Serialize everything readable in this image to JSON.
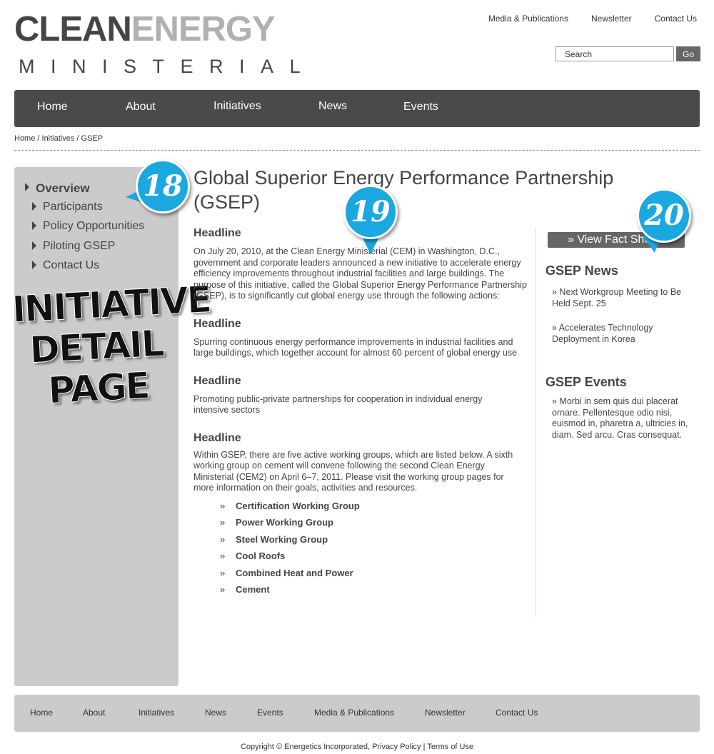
{
  "logo": {
    "word1": "CLEAN",
    "word2": "ENERGY",
    "word3": "MINISTERIAL"
  },
  "toplinks": [
    "Media & Publications",
    "Newsletter",
    "Contact Us"
  ],
  "search": {
    "placeholder": "Search",
    "button": "Go"
  },
  "mainnav": [
    "Home",
    "About",
    "Initiatives",
    "News",
    "Events"
  ],
  "breadcrumb": "Home / Initiatives / GSEP",
  "sidebar": {
    "items": [
      {
        "label": "Overview",
        "active": true
      },
      {
        "label": "Participants"
      },
      {
        "label": "Policy Opportunities"
      },
      {
        "label": "Piloting GSEP"
      },
      {
        "label": "Contact Us"
      }
    ],
    "stamp": [
      "INITIATIVE",
      "DETAIL",
      "PAGE"
    ]
  },
  "callouts": [
    "18",
    "19",
    "20"
  ],
  "main": {
    "title": "Global Superior Energy Performance Partnership (GSEP)",
    "sections": [
      {
        "heading": "Headline",
        "text": "On July 20, 2010, at the Clean Energy Ministerial (CEM) in Washington, D.C., government and corporate leaders announced a new initiative to accelerate energy efficiency improvements throughout industrial facilities and large buildings. The purpose of this initiative, called the Global Superior Energy Performance Partnership (GSEP), is to significantly cut global energy use through the following actions:"
      },
      {
        "heading": "Headline",
        "text": "Spurring continuous energy performance improvements in industrial facilities and large buildings, which together account for almost 60 percent of global energy use"
      },
      {
        "heading": "Headline",
        "text": "Promoting public-private partnerships for cooperation in individual energy intensive sectors"
      },
      {
        "heading": "Headline",
        "text": "Within GSEP, there are five active working groups, which are listed below. A sixth working group on cement will convene following the second Clean Energy Ministerial (CEM2) on April 6–7, 2011. Please visit the working group pages for more information on their goals, activities and resources."
      }
    ],
    "bullet": "»",
    "working_groups": [
      "Certification Working Group",
      "Power Working Group",
      "Steel Working Group",
      "Cool Roofs",
      "Combined Heat and Power",
      "Cement"
    ]
  },
  "right": {
    "factsheet": "»  View Fact Sheet",
    "news_title": "GSEP News",
    "news": [
      "» Next Workgroup Meeting to Be Held Sept. 25",
      "» Accelerates Technology Deployment in Korea"
    ],
    "events_title": "GSEP Events",
    "events": [
      "» Morbi in sem quis dui placerat ornare. Pellentesque odio nisi, euismod in, pharetra a, ultricies in, diam. Sed arcu. Cras consequat."
    ]
  },
  "footer": {
    "nav": [
      "Home",
      "About",
      "Initiatives",
      "News",
      "Events",
      "Media & Publications",
      "Newsletter",
      "Contact Us"
    ],
    "copyright": "Copyright © Energetics Incorporated, Privacy Policy |  Terms of Use"
  },
  "colors": {
    "nav_bg": "#4a4a4a",
    "sidebar_bg": "#cbcbcb",
    "callout": "#1ba7e0"
  }
}
